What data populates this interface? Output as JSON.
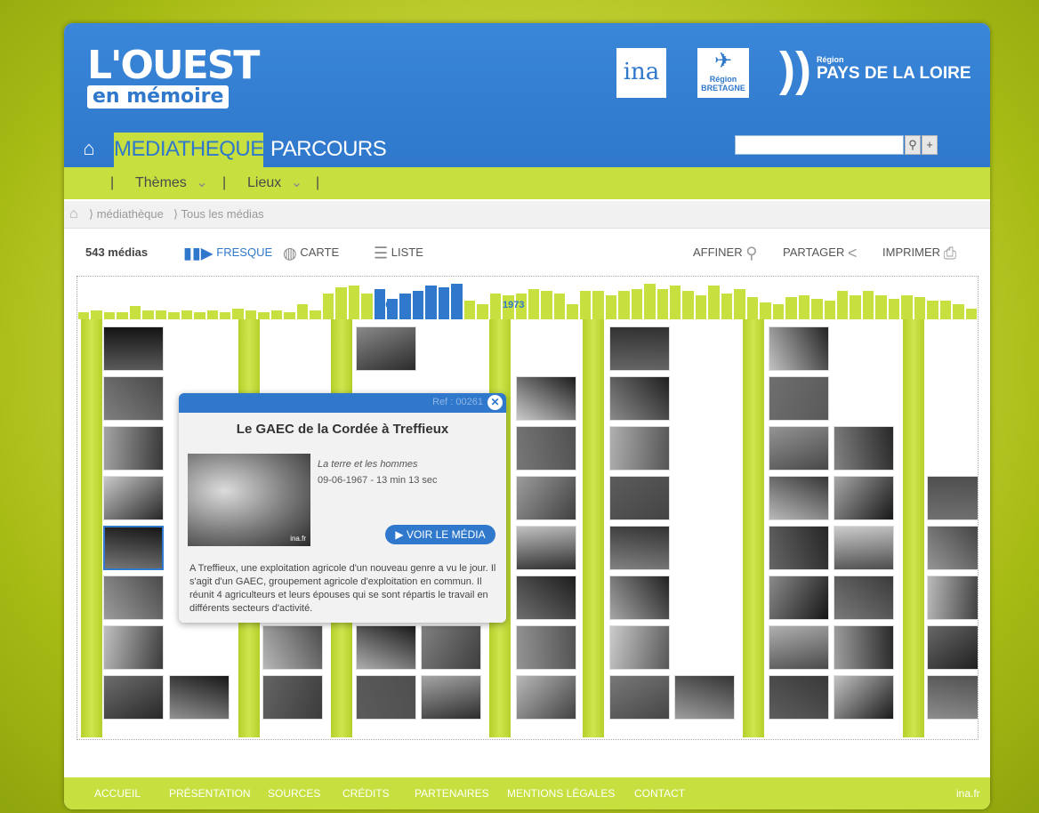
{
  "header": {
    "logo_line1": "L'OUEST",
    "logo_line2": "en mémoire",
    "partners": {
      "ina": "ina",
      "bretagne_region": "Région",
      "bretagne_name": "BRETAGNE",
      "pdl_region": "Région",
      "pdl_name": "PAYS DE LA LOIRE"
    }
  },
  "nav": {
    "home_icon": "home-icon",
    "tabs": [
      {
        "label": "MEDIATHEQUE",
        "active": true
      },
      {
        "label": "PARCOURS",
        "active": false
      }
    ],
    "search": {
      "value": "",
      "search_icon": "magnifier-icon",
      "add_icon": "plus-icon"
    }
  },
  "subnav": {
    "items": [
      "Thèmes",
      "Lieux"
    ],
    "separator": "|",
    "chevron": "⌄"
  },
  "breadcrumb": {
    "items": [
      "médiathèque",
      "Tous les médias"
    ],
    "separator": "⟩"
  },
  "toolbar": {
    "count": "543 médias",
    "views": [
      {
        "label": "FRESQUE",
        "icon": "fresque-icon",
        "active": true
      },
      {
        "label": "CARTE",
        "icon": "globe-icon",
        "active": false
      },
      {
        "label": "LISTE",
        "icon": "list-icon",
        "active": false
      }
    ],
    "actions": [
      {
        "label": "AFFINER",
        "icon": "search-icon"
      },
      {
        "label": "PARTAGER",
        "icon": "share-icon"
      },
      {
        "label": "IMPRIMER",
        "icon": "printer-icon"
      }
    ]
  },
  "timeline": {
    "range_start": "1967",
    "range_end": "1973",
    "counts": [
      2,
      3,
      2,
      2,
      5,
      3,
      3,
      2,
      3,
      2,
      3,
      2,
      4,
      3,
      2,
      3,
      2,
      6,
      3,
      12,
      15,
      16,
      12,
      14,
      9,
      12,
      13,
      16,
      15,
      17,
      8,
      6,
      12,
      11,
      12,
      14,
      13,
      12,
      6,
      13,
      13,
      11,
      13,
      14,
      17,
      14,
      16,
      13,
      11,
      16,
      12,
      14,
      10,
      7,
      6,
      10,
      11,
      9,
      8,
      13,
      11,
      13,
      11,
      9,
      11,
      10,
      8,
      8,
      6,
      4
    ],
    "selected_range_indices": [
      23,
      29
    ],
    "accent": "#2f78cc",
    "green": "#c7e040"
  },
  "popup": {
    "ref": "Ref : 00261",
    "close_icon": "close-icon",
    "title": "Le GAEC de la Cordée à Treffieux",
    "series": "La terre et les hommes",
    "date_duration": "09-06-1967 - 13 min 13 sec",
    "watermark": "ina.fr",
    "voir_button": "VOIR LE MÉDIA",
    "description": "A Treffieux, une exploitation agricole d'un nouveau genre a vu le jour. Il s'agit d'un GAEC, groupement agricole d'exploitation en commun. Il réunit 4 agriculteurs et leurs épouses qui se sont répartis le travail en différents secteurs d'activité."
  },
  "footer": {
    "links": [
      "ACCUEIL",
      "PRÉSENTATION",
      "SOURCES",
      "CRÉDITS",
      "PARTENAIRES",
      "MENTIONS LÉGALES",
      "CONTACT"
    ],
    "brand": "ina.fr"
  }
}
